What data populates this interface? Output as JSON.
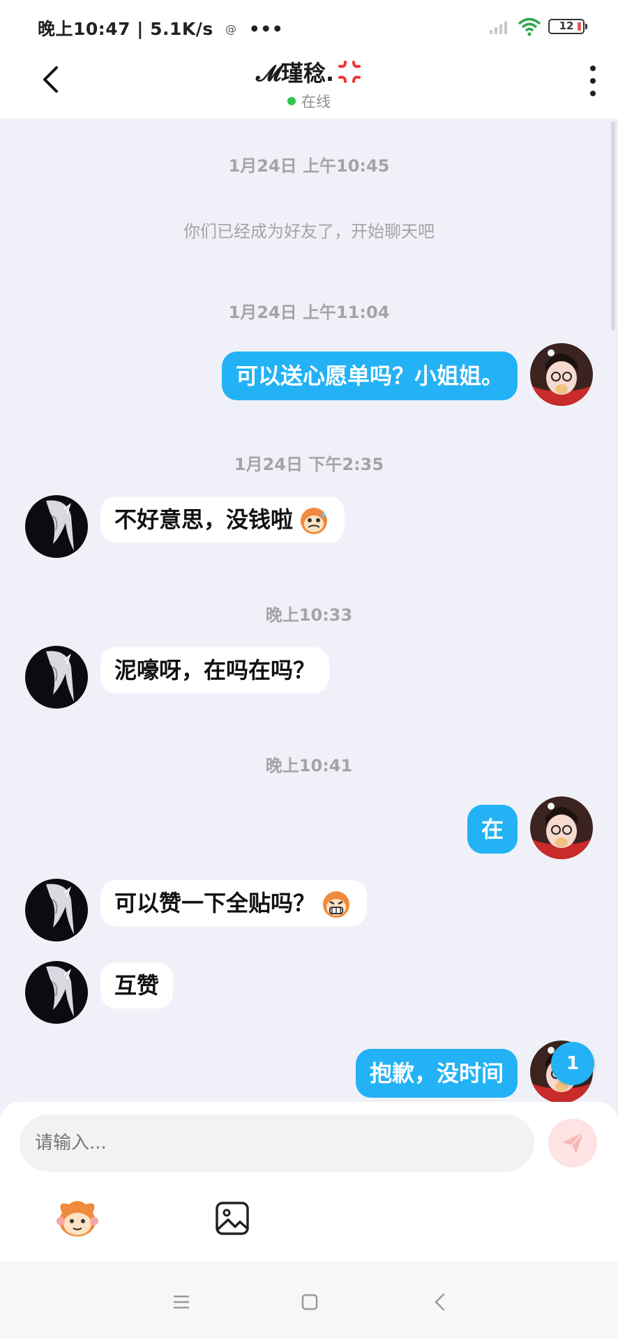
{
  "status_bar": {
    "time": "晚上10:47",
    "net_speed": "5.1K/s",
    "battery_level": "12"
  },
  "header": {
    "back_label": "",
    "contact_name": "𝓜瑾稔.",
    "presence": "在线"
  },
  "chat": {
    "timestamps": [
      "1月24日 上午10:45",
      "1月24日 上午11:04",
      "1月24日 下午2:35",
      "晚上10:33",
      "晚上10:41"
    ],
    "system_message": "你们已经成为好友了，开始聊天吧",
    "messages": [
      {
        "from": "me",
        "text": "可以送心愿单吗？小姐姐。"
      },
      {
        "from": "them",
        "text": "不好意思，没钱啦",
        "emoji": "monkey-sweat"
      },
      {
        "from": "them",
        "text": "泥嚎呀，在吗在吗？"
      },
      {
        "from": "me",
        "text": "在"
      },
      {
        "from": "them",
        "text": "可以赞一下全贴吗？",
        "emoji": "monkey-grin"
      },
      {
        "from": "them",
        "text": "互赞"
      },
      {
        "from": "me",
        "text": "抱歉，没时间"
      }
    ],
    "unread_badge": "1"
  },
  "composer": {
    "placeholder": "请输入...",
    "send_color": "#fde3e3"
  },
  "colors": {
    "accent": "#23b2f5",
    "background": "#f0f1f8",
    "online": "#2dc84d"
  }
}
